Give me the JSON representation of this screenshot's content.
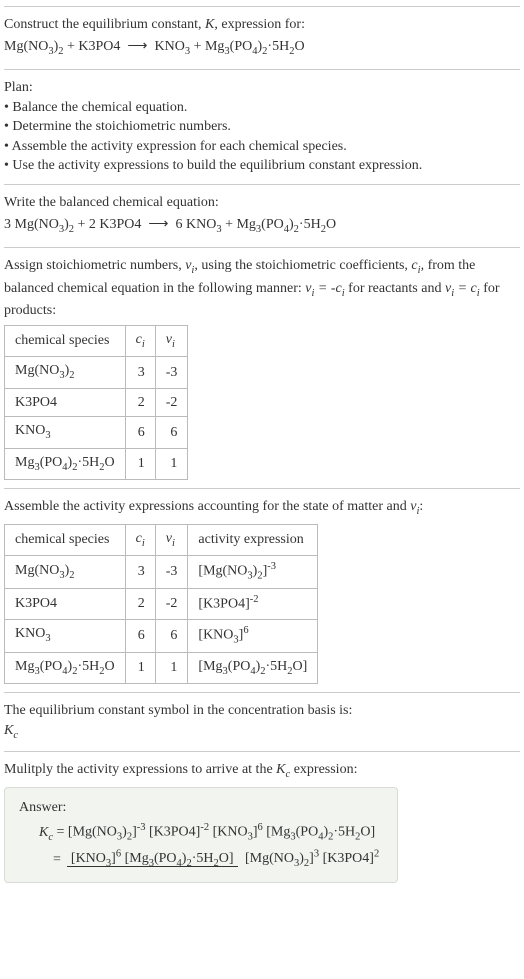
{
  "intro": {
    "line1a": "Construct the equilibrium constant, ",
    "line1b": ", expression for:"
  },
  "plan": {
    "heading": "Plan:",
    "items": [
      "Balance the chemical equation.",
      "Determine the stoichiometric numbers.",
      "Assemble the activity expression for each chemical species.",
      "Use the activity expressions to build the equilibrium constant expression."
    ]
  },
  "balanced": {
    "heading": "Write the balanced chemical equation:"
  },
  "stoich": {
    "text1": "Assign stoichiometric numbers, ",
    "text2": ", using the stoichiometric coefficients, ",
    "text3": ", from the balanced chemical equation in the following manner: ",
    "text4": " for reactants and ",
    "text5": " for products:",
    "headers": {
      "species": "chemical species",
      "ci": "cᵢ",
      "vi": "νᵢ"
    },
    "rows": [
      {
        "species": "Mg(NO3)2",
        "ci": "3",
        "vi": "-3"
      },
      {
        "species": "K3PO4",
        "ci": "2",
        "vi": "-2"
      },
      {
        "species": "KNO3",
        "ci": "6",
        "vi": "6"
      },
      {
        "species": "Mg3(PO4)2·5H2O",
        "ci": "1",
        "vi": "1"
      }
    ]
  },
  "activity": {
    "text1": "Assemble the activity expressions accounting for the state of matter and ",
    "text2": ":",
    "headers": {
      "species": "chemical species",
      "ci": "cᵢ",
      "vi": "νᵢ",
      "expr": "activity expression"
    },
    "rows": [
      {
        "ci": "3",
        "vi": "-3"
      },
      {
        "ci": "2",
        "vi": "-2"
      },
      {
        "ci": "6",
        "vi": "6"
      },
      {
        "ci": "1",
        "vi": "1"
      }
    ]
  },
  "symbol": {
    "text": "The equilibrium constant symbol in the concentration basis is:"
  },
  "multiply": {
    "text1": "Mulitply the activity expressions to arrive at the ",
    "text2": " expression:"
  },
  "answer": {
    "label": "Answer:"
  }
}
